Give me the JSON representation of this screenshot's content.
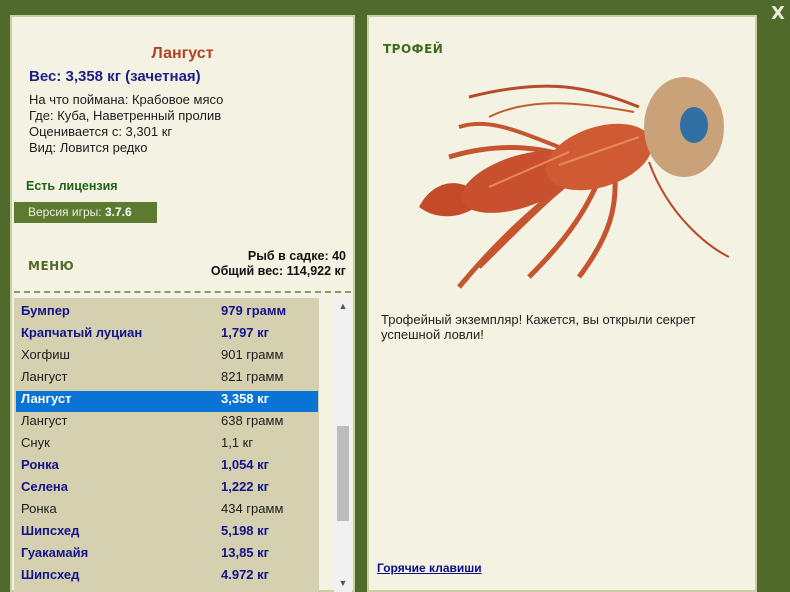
{
  "close_label": "X",
  "details": {
    "name": "Лангуст",
    "weight_line": "Вес: 3,358 кг (зачетная)",
    "bait_line": "На что поймана: Крабовое мясо",
    "where_line": "Где: Куба, Наветренный пролив",
    "value_line": "Оценивается с: 3,301 кг",
    "species_line": "Вид: Ловится редко"
  },
  "license": "Есть лицензия",
  "version": {
    "label": "Версия игры:",
    "value": "3.7.6"
  },
  "menu_label": "МЕНЮ",
  "stats": {
    "fish_in_keepnet": "Рыб в садке: 40",
    "total_weight": "Общий вес: 114,922 кг"
  },
  "fish_list": [
    {
      "name": "Бумпер",
      "weight": "979 грамм",
      "bold": true,
      "selected": false
    },
    {
      "name": "Крапчатый луциан",
      "weight": "1,797 кг",
      "bold": true,
      "selected": false
    },
    {
      "name": "Хогфиш",
      "weight": "901 грамм",
      "bold": false,
      "selected": false
    },
    {
      "name": "Лангуст",
      "weight": "821 грамм",
      "bold": false,
      "selected": false
    },
    {
      "name": "Лангуст",
      "weight": "3,358 кг",
      "bold": true,
      "selected": true
    },
    {
      "name": "Лангуст",
      "weight": "638 грамм",
      "bold": false,
      "selected": false
    },
    {
      "name": "Снук",
      "weight": "1,1 кг",
      "bold": false,
      "selected": false
    },
    {
      "name": "Ронка",
      "weight": "1,054 кг",
      "bold": true,
      "selected": false
    },
    {
      "name": "Селена",
      "weight": "1,222 кг",
      "bold": true,
      "selected": false
    },
    {
      "name": "Ронка",
      "weight": "434 грамм",
      "bold": false,
      "selected": false
    },
    {
      "name": "Шипсхед",
      "weight": "5,198 кг",
      "bold": true,
      "selected": false
    },
    {
      "name": "Гуакамайя",
      "weight": "13,85 кг",
      "bold": true,
      "selected": false
    },
    {
      "name": "Шипсхед",
      "weight": "4.972 кг",
      "bold": true,
      "selected": false
    }
  ],
  "trophy": {
    "title": "ТРОФЕЙ",
    "message": "Трофейный экземпляр! Кажется, вы открыли секрет успешной ловли!",
    "image_icon": "lobster-image"
  },
  "hotkeys_link": "Горячие клавиши",
  "colors": {
    "background": "#4f6a2b",
    "panel": "#f4f2e2",
    "list_bg": "#d4d0b0",
    "selection": "#0a74d6",
    "fish_name": "#b3421f",
    "weight_blue": "#1c1f8a",
    "license_green": "#1f6218"
  }
}
